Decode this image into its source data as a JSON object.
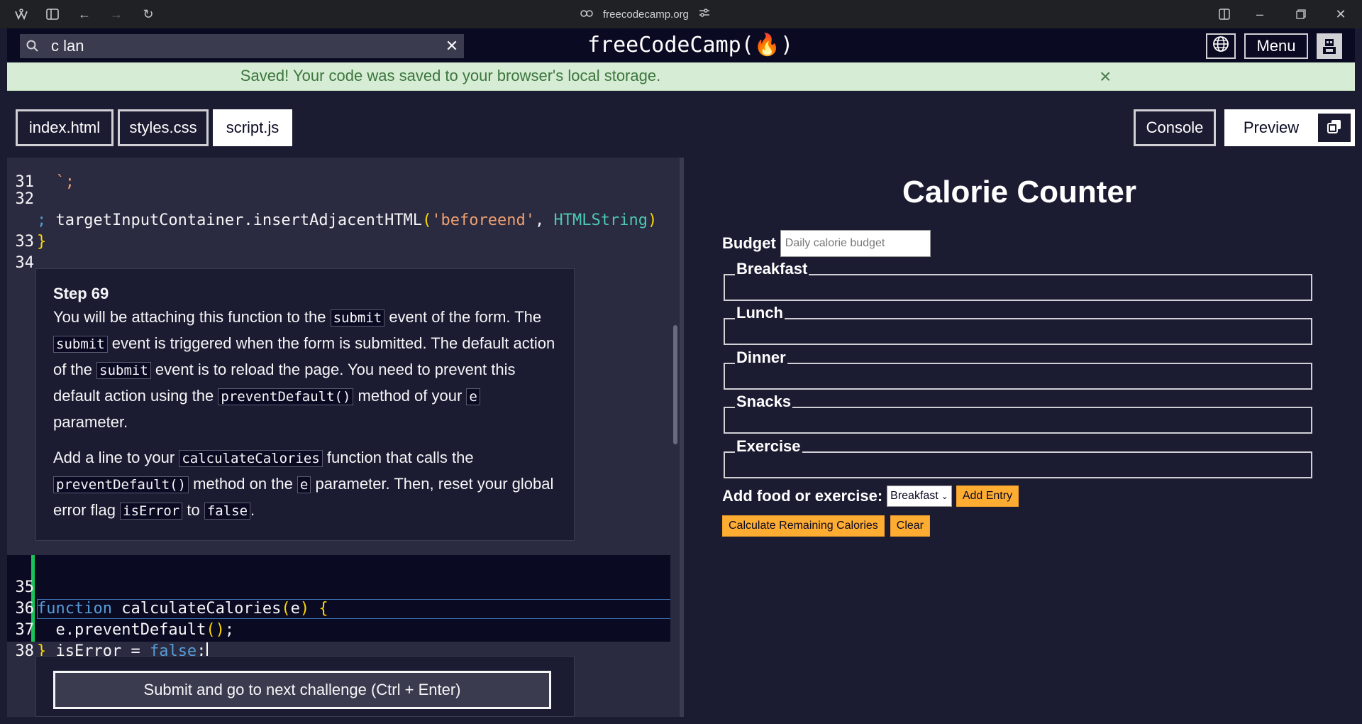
{
  "browser": {
    "url": "freecodecamp.org"
  },
  "nav": {
    "search_value": "c lan",
    "logo": "freeCodeCamp(🔥)",
    "menu_label": "Menu"
  },
  "banner": {
    "message": "Saved! Your code was saved to your browser's local storage."
  },
  "tabs": {
    "files": [
      "index.html",
      "styles.css",
      "script.js"
    ],
    "console_label": "Console",
    "preview_label": "Preview"
  },
  "editor": {
    "lines_top": [
      {
        "num": "31",
        "code": "  `;"
      },
      {
        "num": "32",
        "code": "  targetInputContainer.insertAdjacentHTML('beforeend', HTMLString)"
      },
      {
        "num": "",
        "code": ";"
      },
      {
        "num": "33",
        "code": "}"
      },
      {
        "num": "34",
        "code": ""
      }
    ],
    "lines_bottom": [
      {
        "num": "35",
        "code": "function calculateCalories(e) {"
      },
      {
        "num": "36",
        "code": "  e.preventDefault();"
      },
      {
        "num": "37",
        "code": "  isError = false;"
      },
      {
        "num": "38",
        "code": "}"
      }
    ]
  },
  "step": {
    "title": "Step 69",
    "p1": {
      "t1": "You will be attaching this function to the ",
      "c1": "submit",
      "t2": " event of the form. The ",
      "c2": "submit",
      "t3": " event is triggered when the form is submitted. The default action of the ",
      "c3": "submit",
      "t4": " event is to reload the page. You need to prevent this default action using the ",
      "c4": "preventDefault()",
      "t5": " method of your ",
      "c5": "e",
      "t6": " parameter."
    },
    "p2": {
      "t1": "Add a line to your ",
      "c1": "calculateCalories",
      "t2": " function that calls the ",
      "c2": "preventDefault()",
      "t3": " method on the ",
      "c3": "e",
      "t4": " parameter. Then, reset your global error flag ",
      "c4": "isError",
      "t5": " to ",
      "c5": "false",
      "t6": "."
    },
    "submit_label": "Submit and go to next challenge (Ctrl + Enter)"
  },
  "preview": {
    "title": "Calorie Counter",
    "budget_label": "Budget",
    "budget_placeholder": "Daily calorie budget",
    "fieldsets": [
      "Breakfast",
      "Lunch",
      "Dinner",
      "Snacks",
      "Exercise"
    ],
    "add_label": "Add food or exercise:",
    "select_value": "Breakfast",
    "add_entry": "Add Entry",
    "calculate": "Calculate Remaining Calories",
    "clear": "Clear"
  }
}
